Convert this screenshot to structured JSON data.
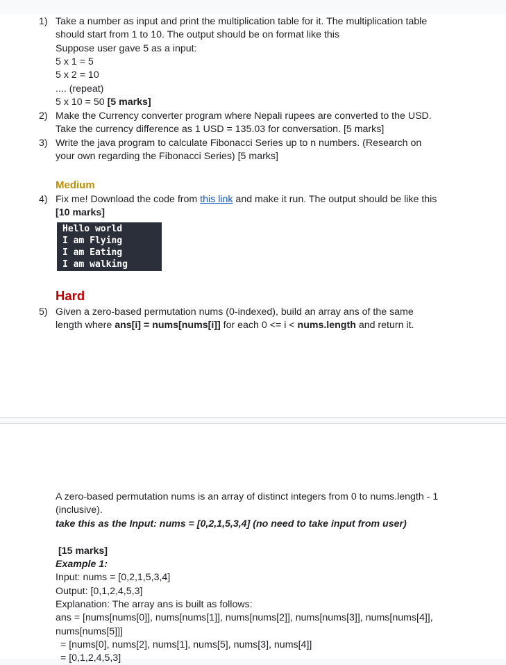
{
  "q1": {
    "number": "1)",
    "line1": "Take a number as input and print the multiplication table for it. The multiplication table",
    "line2": "should start from 1 to 10. The output should be on format like this",
    "line3": "Suppose user gave 5 as a input:",
    "ex1": "5 x 1 = 5",
    "ex2": "5 x 2 = 10",
    "ex3": ".... (repeat)",
    "ex4": "5 x 10 = 50",
    "marks": "[5 marks]"
  },
  "q2": {
    "number": "2)",
    "line1": "Make the Currency converter program where Nepali rupees are converted to the USD.",
    "line2": "Take the currency difference as 1 USD = 135.03 for conversation. [5 marks]"
  },
  "q3": {
    "number": "3)",
    "line1": "Write the java program to  calculate Fibonacci Series up to n numbers. (Research on",
    "line2": "your own regarding the Fibonacci Series) [5 marks]"
  },
  "medium": "Medium",
  "q4": {
    "number": "4)",
    "pre": "Fix me! Download the code from ",
    "link": "this link",
    "post": " and make it run. The output should be like this",
    "marks": "[10 marks]",
    "code": [
      "Hello world",
      "I am Flying",
      "I am Eating",
      "I am walking"
    ]
  },
  "hard": "Hard",
  "q5": {
    "number": "5)",
    "line1": "Given a zero-based permutation nums (0-indexed), build an array ans of the same",
    "l2a": "length where ",
    "l2b": "ans[i] = nums[nums[i]]",
    "l2c": " for each 0 <= i < ",
    "l2d": "nums.length",
    "l2e": " and return it."
  },
  "page2": {
    "p1": "A zero-based permutation nums is an array of distinct integers from 0 to nums.length - 1",
    "p2": "(inclusive).",
    "input_a": "take this as the Input: nums =  ",
    "input_b": "[0,2,1,5,3,4]",
    "input_c": " (no need to take input from user)",
    "marks": "[15 marks]",
    "example": "Example 1:",
    "input": "Input: nums = [0,2,1,5,3,4]",
    "output": "Output: [0,1,2,4,5,3]",
    "explanation": "Explanation: The array ans is built as follows:",
    "ans1": "ans = [nums[nums[0]], nums[nums[1]], nums[nums[2]], nums[nums[3]], nums[nums[4]],",
    "ans2": "nums[nums[5]]]",
    "ans3": "= [nums[0], nums[2], nums[1], nums[5], nums[3], nums[4]]",
    "ans4": "= [0,1,2,4,5,3]"
  }
}
